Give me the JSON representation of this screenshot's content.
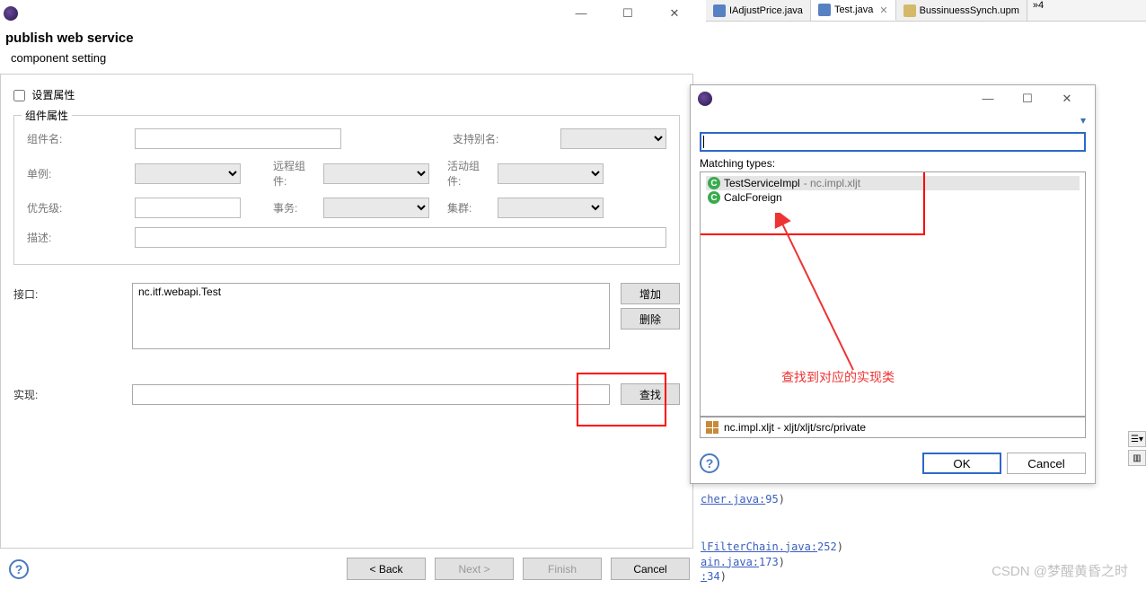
{
  "tabs": [
    {
      "label": "IAdjustPrice.java",
      "type": "java"
    },
    {
      "label": "Test.java",
      "type": "java",
      "active": true
    },
    {
      "label": "BussinuessSynch.upm",
      "type": "upm"
    }
  ],
  "tabs_overflow": "»4",
  "wizard": {
    "title": "publish web service",
    "subtitle": "component setting",
    "set_props_checkbox": "设置属性",
    "group_title": "组件属性",
    "labels": {
      "component_name": "组件名:",
      "support_alias": "支持别名:",
      "singleton": "单例:",
      "remote": "远程组件:",
      "active_component": "活动组件:",
      "priority": "优先级:",
      "transaction": "事务:",
      "cluster": "集群:",
      "description": "描述:",
      "interface": "接口:",
      "implementation": "实现:"
    },
    "interface_value": "nc.itf.webapi.Test",
    "buttons": {
      "add": "增加",
      "delete": "删除",
      "find": "查找",
      "back": "< Back",
      "next": "Next >",
      "finish": "Finish",
      "cancel": "Cancel"
    }
  },
  "popup": {
    "matching_label": "Matching types:",
    "items": [
      {
        "name": "TestServiceImpl",
        "pkg": "nc.impl.xljt",
        "selected": true
      },
      {
        "name": "CalcForeign",
        "pkg": "",
        "selected": false
      }
    ],
    "path": "nc.impl.xljt - xljt/xljt/src/private",
    "ok": "OK",
    "cancel": "Cancel",
    "annotation": "查找到对应的实现类"
  },
  "bg_code": {
    "l1a": "cher.java:",
    "l1b": "95",
    "l2a": "lFilterChain.java:",
    "l2b": "252",
    "l3a": "ain.java:",
    "l3b": "173",
    "l4a": ":",
    "l4b": "34"
  },
  "watermark": "CSDN @梦醒黄昏之时"
}
